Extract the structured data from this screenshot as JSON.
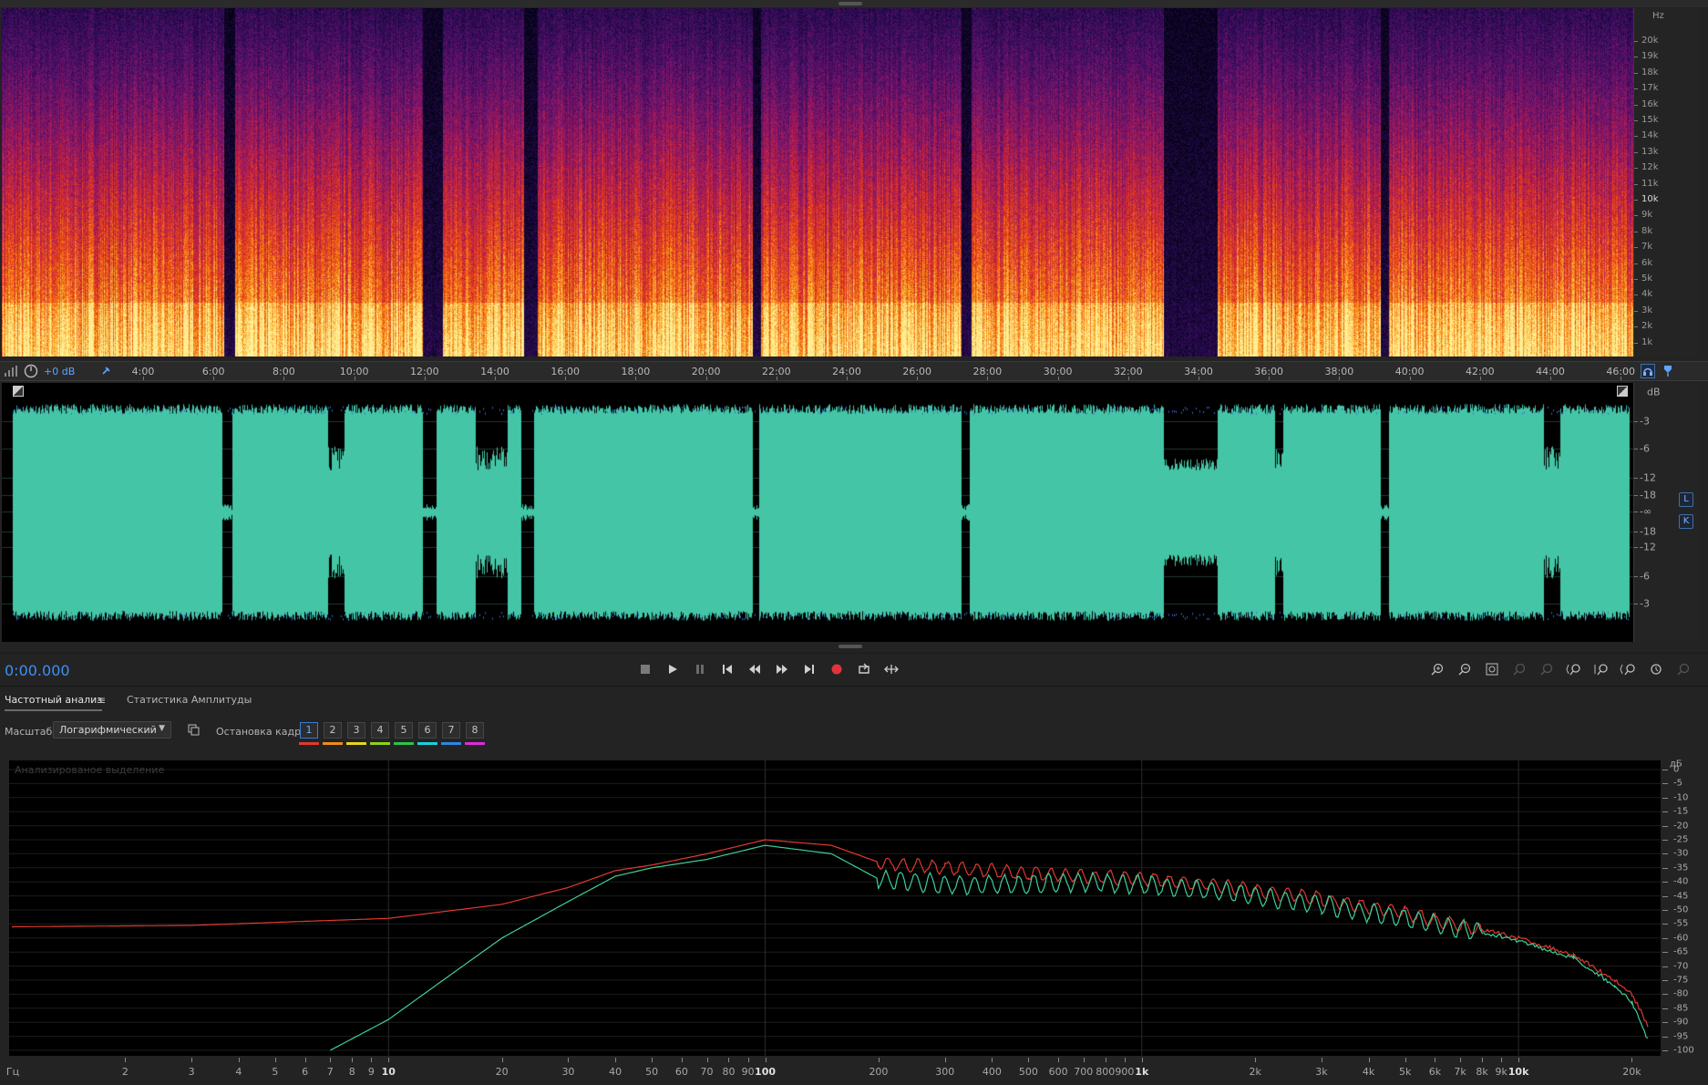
{
  "editor": {
    "volume_db": "+0 dB",
    "time_ruler": [
      "4:00",
      "6:00",
      "8:00",
      "10:00",
      "12:00",
      "14:00",
      "16:00",
      "18:00",
      "20:00",
      "22:00",
      "24:00",
      "26:00",
      "28:00",
      "30:00",
      "32:00",
      "34:00",
      "36:00",
      "38:00",
      "40:00",
      "42:00",
      "44:00",
      "46:00"
    ],
    "time_ruler_minutes": [
      4,
      6,
      8,
      10,
      12,
      14,
      16,
      18,
      20,
      22,
      24,
      26,
      28,
      30,
      32,
      34,
      36,
      38,
      40,
      42,
      44,
      46
    ],
    "spectral": {
      "unit": "Hz",
      "labels": [
        "20k",
        "19k",
        "18k",
        "17k",
        "16k",
        "15k",
        "14k",
        "13k",
        "12k",
        "11k",
        "10k",
        "9k",
        "8k",
        "7k",
        "6k",
        "5k",
        "4k",
        "3k",
        "2k",
        "1k"
      ],
      "strong_label": "10k"
    },
    "waveform": {
      "unit": "dB",
      "labels_top": [
        "-3",
        "-6",
        "-12",
        "-18"
      ],
      "center_label": "-∞",
      "labels_bottom": [
        "-18",
        "-12",
        "-6",
        "-3"
      ],
      "channel_left": "L",
      "channel_right": "K",
      "color": "#44c6a6"
    }
  },
  "transport": {
    "timecode": "0:00.000",
    "buttons": [
      "stop",
      "play",
      "pause",
      "go-to-start",
      "rewind",
      "fast-forward",
      "go-to-end",
      "record",
      "loop",
      "skip-selection"
    ],
    "record_color": "#e0343a"
  },
  "panel": {
    "tabs": [
      {
        "label": "Частотный анализ",
        "active": true
      },
      {
        "label": "Статистика Амплитуды",
        "active": false
      }
    ],
    "scale_label": "Масштаб:",
    "scale_value": "Логарифмический",
    "freeze_label": "Остановка кадра:",
    "frames": [
      {
        "label": "1",
        "color": "#e03a2e",
        "active": true
      },
      {
        "label": "2",
        "color": "#f08a1c",
        "active": false
      },
      {
        "label": "3",
        "color": "#e6d420",
        "active": false
      },
      {
        "label": "4",
        "color": "#8ed21e",
        "active": false
      },
      {
        "label": "5",
        "color": "#2ec24a",
        "active": false
      },
      {
        "label": "6",
        "color": "#1ed0d8",
        "active": false
      },
      {
        "label": "7",
        "color": "#2f86e6",
        "active": false
      },
      {
        "label": "8",
        "color": "#e02ad8",
        "active": false
      }
    ]
  },
  "analysis": {
    "selection_label": "Анализированое выделение",
    "db_unit": "дБ",
    "db_labels": [
      "0",
      "-5",
      "-10",
      "-15",
      "-20",
      "-25",
      "-30",
      "-35",
      "-40",
      "-45",
      "-50",
      "-55",
      "-60",
      "-65",
      "-70",
      "-75",
      "-80",
      "-85",
      "-90",
      "-95",
      "-100"
    ],
    "freq_unit": "Гц",
    "freq_labels": [
      {
        "text": "2",
        "f": 2
      },
      {
        "text": "3",
        "f": 3
      },
      {
        "text": "4",
        "f": 4
      },
      {
        "text": "5",
        "f": 5
      },
      {
        "text": "6",
        "f": 6
      },
      {
        "text": "7",
        "f": 7
      },
      {
        "text": "8",
        "f": 8
      },
      {
        "text": "9",
        "f": 9
      },
      {
        "text": "10",
        "f": 10,
        "strong": true
      },
      {
        "text": "20",
        "f": 20
      },
      {
        "text": "30",
        "f": 30
      },
      {
        "text": "40",
        "f": 40
      },
      {
        "text": "50",
        "f": 50
      },
      {
        "text": "60",
        "f": 60
      },
      {
        "text": "70",
        "f": 70
      },
      {
        "text": "80",
        "f": 80
      },
      {
        "text": "90",
        "f": 90
      },
      {
        "text": "100",
        "f": 100,
        "strong": true
      },
      {
        "text": "200",
        "f": 200
      },
      {
        "text": "300",
        "f": 300
      },
      {
        "text": "400",
        "f": 400
      },
      {
        "text": "500",
        "f": 500
      },
      {
        "text": "600",
        "f": 600
      },
      {
        "text": "700",
        "f": 700
      },
      {
        "text": "800",
        "f": 800
      },
      {
        "text": "900",
        "f": 900
      },
      {
        "text": "1k",
        "f": 1000,
        "strong": true
      },
      {
        "text": "2k",
        "f": 2000
      },
      {
        "text": "3k",
        "f": 3000
      },
      {
        "text": "4k",
        "f": 4000
      },
      {
        "text": "5k",
        "f": 5000
      },
      {
        "text": "6k",
        "f": 6000
      },
      {
        "text": "7k",
        "f": 7000
      },
      {
        "text": "8k",
        "f": 8000
      },
      {
        "text": "9k",
        "f": 9000
      },
      {
        "text": "10k",
        "f": 10000,
        "strong": true
      },
      {
        "text": "20k",
        "f": 20000
      }
    ],
    "freq_range_hz": [
      1,
      22050
    ],
    "db_range": [
      -100,
      0
    ],
    "series": [
      {
        "color": "#e03a2e",
        "points": [
          [
            1,
            -56
          ],
          [
            3,
            -55.5
          ],
          [
            10,
            -53
          ],
          [
            20,
            -48
          ],
          [
            30,
            -42
          ],
          [
            40,
            -36
          ],
          [
            50,
            -34
          ],
          [
            70,
            -30
          ],
          [
            100,
            -25
          ],
          [
            150,
            -27
          ],
          [
            200,
            -33
          ],
          [
            300,
            -35
          ],
          [
            500,
            -37
          ],
          [
            700,
            -38
          ],
          [
            1000,
            -39
          ],
          [
            1500,
            -41
          ],
          [
            2000,
            -43
          ],
          [
            3000,
            -46
          ],
          [
            4000,
            -49
          ],
          [
            5000,
            -51
          ],
          [
            6000,
            -54
          ],
          [
            8000,
            -57
          ],
          [
            10000,
            -60
          ],
          [
            14000,
            -66
          ],
          [
            18000,
            -75
          ],
          [
            20000,
            -80
          ],
          [
            22050,
            -91
          ]
        ]
      },
      {
        "color": "#3ecf9a",
        "points": [
          [
            7,
            -100
          ],
          [
            10,
            -89
          ],
          [
            15,
            -72
          ],
          [
            20,
            -60
          ],
          [
            30,
            -47
          ],
          [
            40,
            -38
          ],
          [
            50,
            -35
          ],
          [
            70,
            -32
          ],
          [
            100,
            -27
          ],
          [
            150,
            -30
          ],
          [
            200,
            -39
          ],
          [
            300,
            -41
          ],
          [
            500,
            -41
          ],
          [
            700,
            -40
          ],
          [
            1000,
            -41
          ],
          [
            1500,
            -43
          ],
          [
            2000,
            -45
          ],
          [
            3000,
            -48
          ],
          [
            4000,
            -51
          ],
          [
            5000,
            -53
          ],
          [
            6000,
            -55
          ],
          [
            8000,
            -58
          ],
          [
            10000,
            -61
          ],
          [
            14000,
            -67
          ],
          [
            18000,
            -77
          ],
          [
            20000,
            -83
          ],
          [
            22050,
            -96
          ]
        ]
      }
    ]
  }
}
